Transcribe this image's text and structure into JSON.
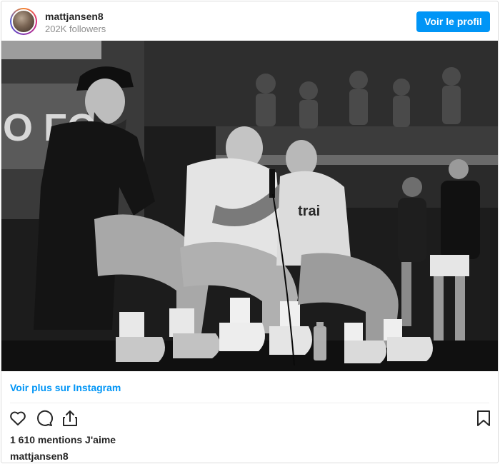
{
  "header": {
    "username": "mattjansen8",
    "followers": "202K followers",
    "profile_button": "Voir le profil"
  },
  "post": {
    "banner_text": "O FO",
    "shirt_text": "trai",
    "see_more_link": "Voir plus sur Instagram",
    "likes": "1 610 mentions J'aime",
    "caption_username": "mattjansen8"
  },
  "icons": {
    "like": "heart-icon",
    "comment": "comment-icon",
    "share": "share-icon",
    "save": "bookmark-icon"
  },
  "colors": {
    "accent": "#0095f6",
    "text": "#262626",
    "secondary": "#8e8e8e"
  }
}
